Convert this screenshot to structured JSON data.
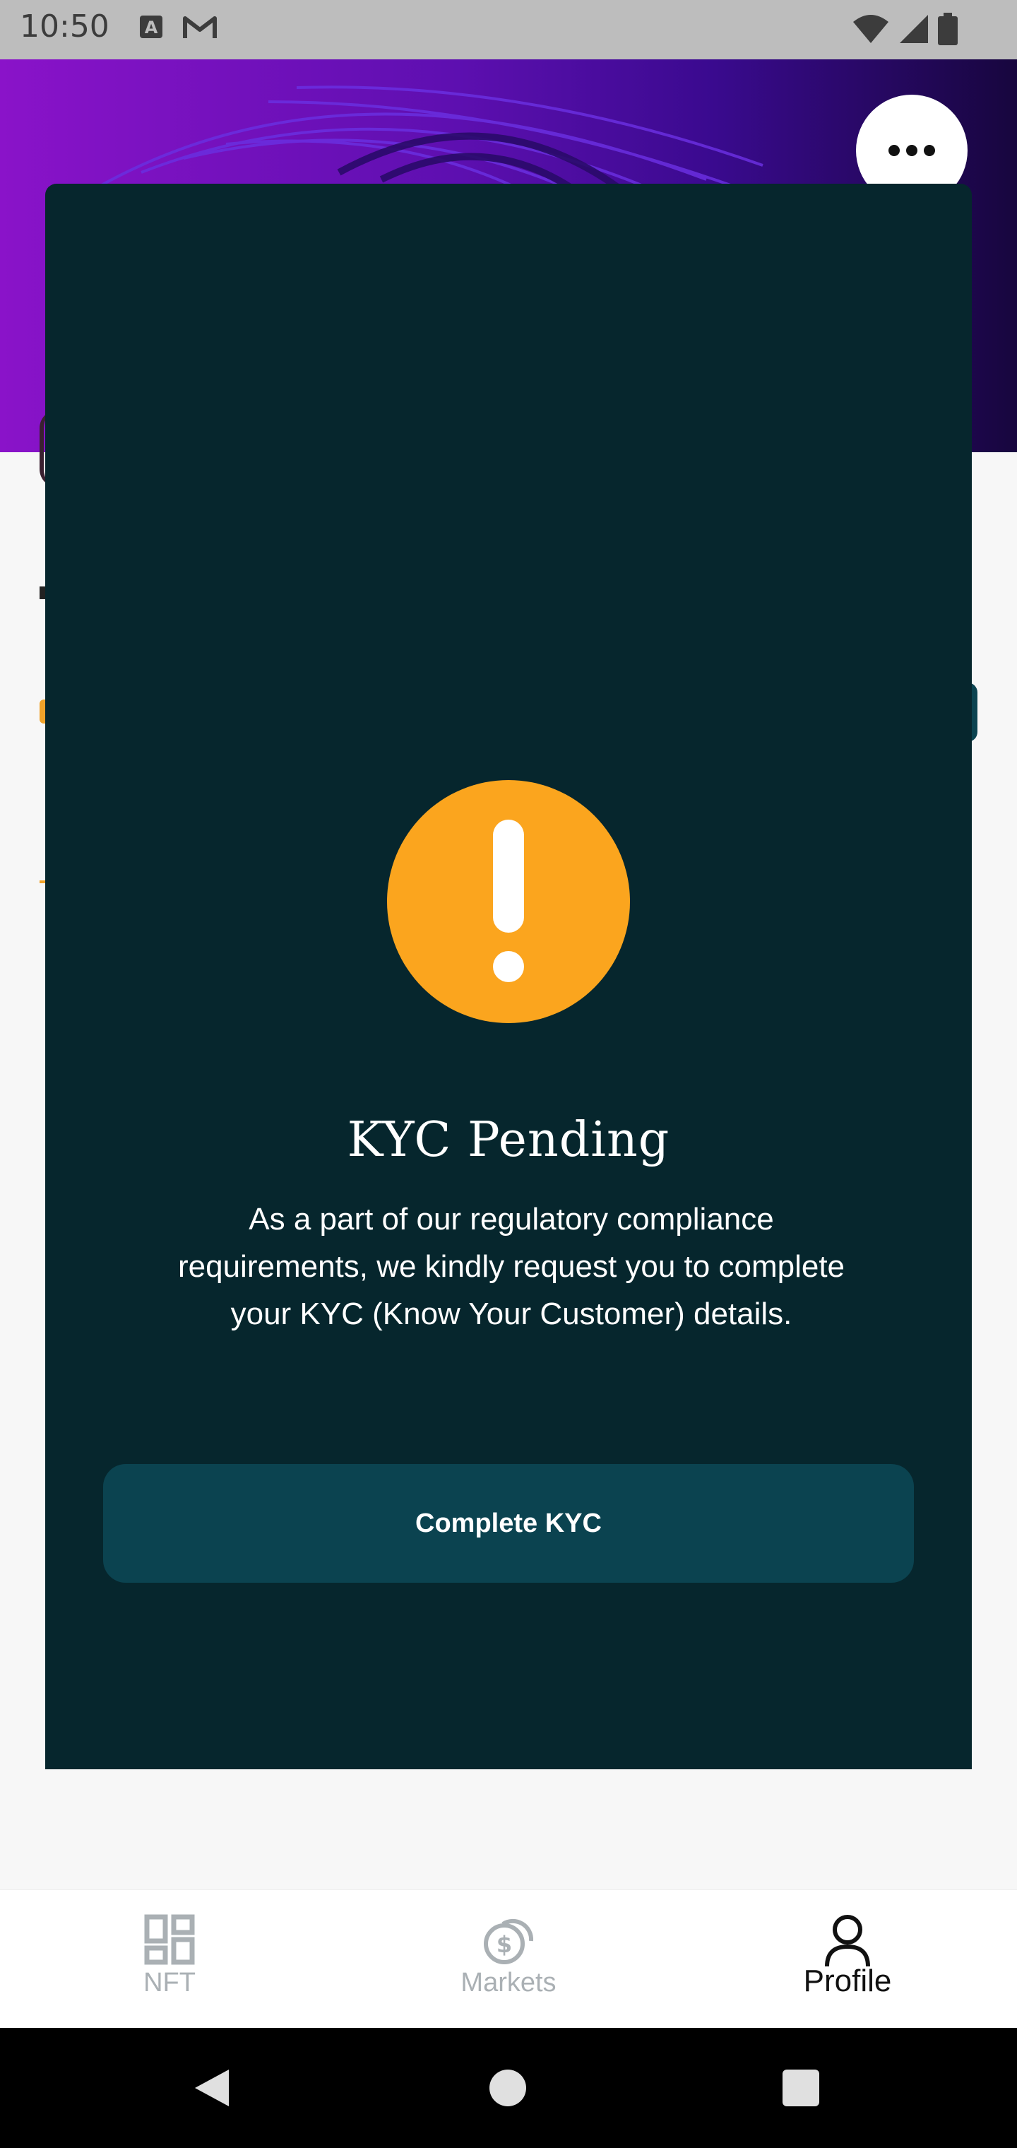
{
  "status_bar": {
    "time": "10:50",
    "left_icons": [
      "a-badge-icon",
      "gmail-icon"
    ],
    "right_icons": [
      "wifi-icon",
      "signal-icon",
      "battery-icon"
    ]
  },
  "header": {
    "more_icon": "more-horizontal-icon"
  },
  "kyc_modal": {
    "icon": "exclamation-icon",
    "accent_color": "#fba51e",
    "background_color": "#06262d",
    "title": "KYC Pending",
    "message": "As a part of our regulatory compliance requirements, we kindly request you to complete your KYC (Know Your Customer) details.",
    "button_label": "Complete KYC"
  },
  "bottom_nav": {
    "items": [
      {
        "label": "NFT",
        "icon": "grid-icon",
        "active": false
      },
      {
        "label": "Markets",
        "icon": "coins-icon",
        "active": false
      },
      {
        "label": "Profile",
        "icon": "user-icon",
        "active": true
      }
    ]
  },
  "system_nav": {
    "back_icon": "back-triangle-icon",
    "home_icon": "home-circle-icon",
    "recents_icon": "recents-square-icon"
  }
}
